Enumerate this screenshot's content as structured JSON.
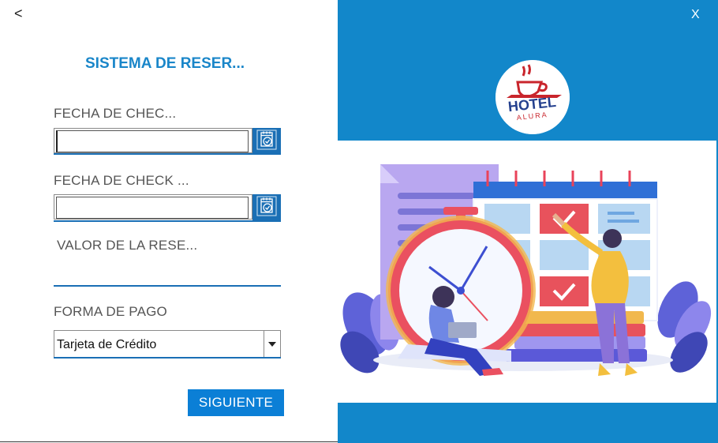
{
  "window": {
    "back_label": "<",
    "close_label": "X"
  },
  "form": {
    "title": "SISTEMA DE RESER...",
    "checkin_label": "FECHA DE CHEC...",
    "checkout_label": "FECHA DE CHECK ...",
    "value_label": "VALOR DE LA RESE...",
    "payment_label": "FORMA DE PAGO",
    "payment_value": "Tarjeta de Crédito",
    "checkin_value": "",
    "checkout_value": "",
    "amount_value": "",
    "next_label": "SIGUIENTE"
  },
  "brand": {
    "line1": "HOTEL",
    "line2": "ALURA"
  },
  "colors": {
    "accent": "#1a86c9",
    "panel": "#1287ca",
    "button": "#0b7fd6",
    "calendar_button": "#1a6fb5"
  },
  "icons": [
    "back-icon",
    "calendar-icon",
    "chevron-down-icon",
    "close-icon",
    "coffee-cup-icon"
  ]
}
